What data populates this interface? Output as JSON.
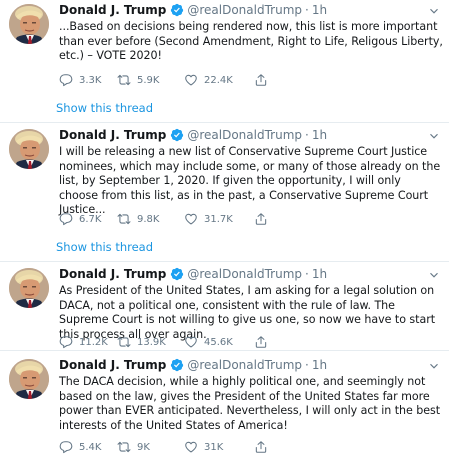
{
  "tweets": [
    {
      "name": "Donald J. Trump",
      "handle": "@realDonaldTrump",
      "separator": "·",
      "time": "1h",
      "text": "...Based on decisions being rendered now, this list is more important than ever before (Second Amendment, Right to Life, Religous Liberty, etc.) – VOTE 2020!",
      "replies": "3.3K",
      "retweets": "5.9K",
      "likes": "22.4K",
      "show_thread": "Show this thread"
    },
    {
      "name": "Donald J. Trump",
      "handle": "@realDonaldTrump",
      "separator": "·",
      "time": "1h",
      "text": "I will be releasing a new list of Conservative Supreme Court Justice nominees, which may include some, or many of those already on the list, by September 1, 2020. If given the opportunity, I will only choose from this list, as in the past, a Conservative Supreme Court Justice...",
      "replies": "6.7K",
      "retweets": "9.8K",
      "likes": "31.7K",
      "show_thread": "Show this thread"
    },
    {
      "name": "Donald J. Trump",
      "handle": "@realDonaldTrump",
      "separator": "·",
      "time": "1h",
      "text": "As President of the United States, I am asking for a legal solution on DACA, not a political one, consistent with the rule of law. The Supreme Court is not willing to give us one, so now we have to start this process all over again.",
      "replies": "11.2K",
      "retweets": "13.9K",
      "likes": "45.6K"
    },
    {
      "name": "Donald J. Trump",
      "handle": "@realDonaldTrump",
      "separator": "·",
      "time": "1h",
      "text": "The DACA decision, while a highly political one, and seemingly not based on the law, gives the President of the United States far more power than EVER anticipated. Nevertheless, I will only act in the best interests of the United States of America!",
      "replies": "5.4K",
      "retweets": "9K",
      "likes": "31K"
    }
  ],
  "colors": {
    "name": "#14171a",
    "secondary": "#657786",
    "link": "#1b95e0",
    "verified": "#1da1f2",
    "border": "#e6ecf0"
  },
  "icons": {
    "verified": "verified-badge-icon",
    "caret": "chevron-down-icon",
    "reply": "reply-icon",
    "retweet": "retweet-icon",
    "like": "heart-icon",
    "share": "share-icon"
  }
}
